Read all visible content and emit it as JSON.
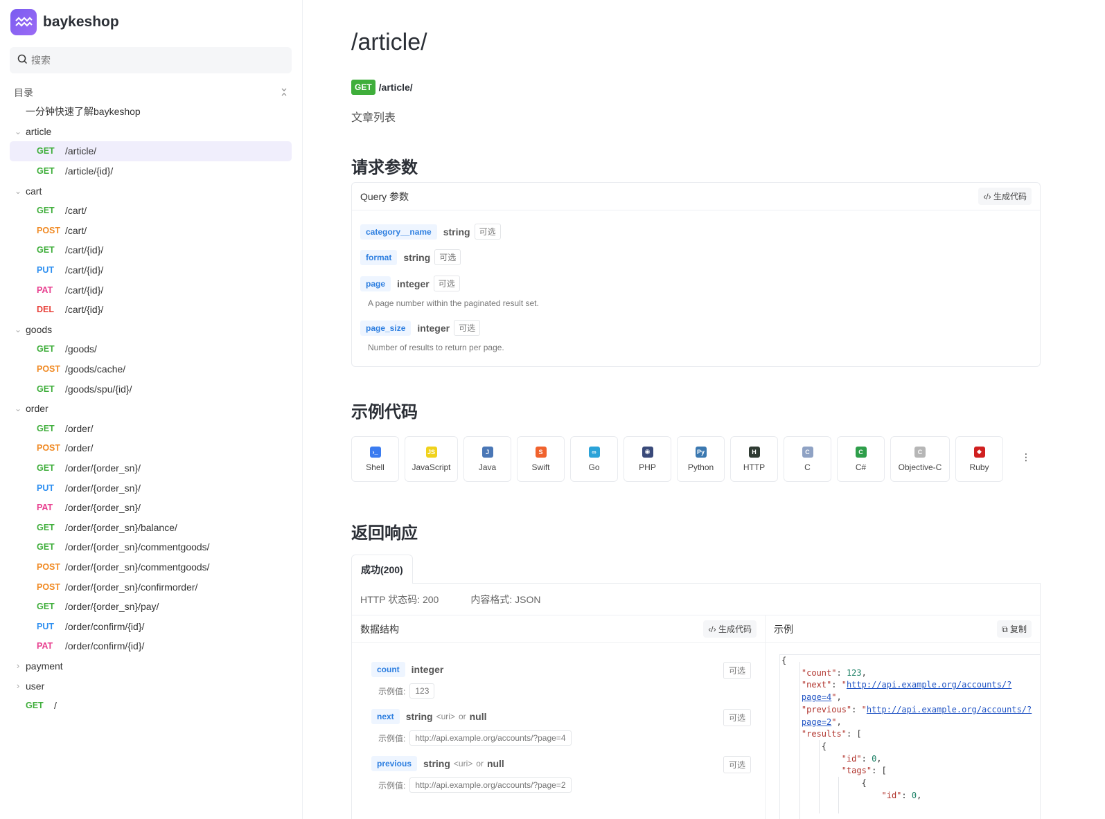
{
  "brand": {
    "name": "baykeshop"
  },
  "search": {
    "placeholder": "搜索"
  },
  "toc": {
    "label": "目录",
    "items": [
      {
        "type": "doc",
        "label": "一分钟快速了解baykeshop"
      },
      {
        "type": "group",
        "label": "article",
        "open": true
      },
      {
        "type": "api",
        "method": "GET",
        "path": "/article/",
        "active": true
      },
      {
        "type": "api",
        "method": "GET",
        "path": "/article/{id}/"
      },
      {
        "type": "group",
        "label": "cart",
        "open": true
      },
      {
        "type": "api",
        "method": "GET",
        "path": "/cart/"
      },
      {
        "type": "api",
        "method": "POST",
        "path": "/cart/"
      },
      {
        "type": "api",
        "method": "GET",
        "path": "/cart/{id}/"
      },
      {
        "type": "api",
        "method": "PUT",
        "path": "/cart/{id}/"
      },
      {
        "type": "api",
        "method": "PAT",
        "path": "/cart/{id}/"
      },
      {
        "type": "api",
        "method": "DEL",
        "path": "/cart/{id}/"
      },
      {
        "type": "group",
        "label": "goods",
        "open": true
      },
      {
        "type": "api",
        "method": "GET",
        "path": "/goods/"
      },
      {
        "type": "api",
        "method": "POST",
        "path": "/goods/cache/"
      },
      {
        "type": "api",
        "method": "GET",
        "path": "/goods/spu/{id}/"
      },
      {
        "type": "group",
        "label": "order",
        "open": true
      },
      {
        "type": "api",
        "method": "GET",
        "path": "/order/"
      },
      {
        "type": "api",
        "method": "POST",
        "path": "/order/"
      },
      {
        "type": "api",
        "method": "GET",
        "path": "/order/{order_sn}/"
      },
      {
        "type": "api",
        "method": "PUT",
        "path": "/order/{order_sn}/"
      },
      {
        "type": "api",
        "method": "PAT",
        "path": "/order/{order_sn}/"
      },
      {
        "type": "api",
        "method": "GET",
        "path": "/order/{order_sn}/balance/"
      },
      {
        "type": "api",
        "method": "GET",
        "path": "/order/{order_sn}/commentgoods/"
      },
      {
        "type": "api",
        "method": "POST",
        "path": "/order/{order_sn}/commentgoods/"
      },
      {
        "type": "api",
        "method": "POST",
        "path": "/order/{order_sn}/confirmorder/"
      },
      {
        "type": "api",
        "method": "GET",
        "path": "/order/{order_sn}/pay/"
      },
      {
        "type": "api",
        "method": "PUT",
        "path": "/order/confirm/{id}/"
      },
      {
        "type": "api",
        "method": "PAT",
        "path": "/order/confirm/{id}/"
      },
      {
        "type": "group",
        "label": "payment",
        "open": false
      },
      {
        "type": "group",
        "label": "user",
        "open": false
      },
      {
        "type": "root",
        "method": "GET",
        "path": "/"
      }
    ]
  },
  "page": {
    "title": "/article/",
    "method": "GET",
    "path": "/article/",
    "description": "文章列表"
  },
  "request": {
    "heading": "请求参数",
    "panel_title": "Query 参数",
    "gen_code": "生成代码",
    "params": [
      {
        "name": "category__name",
        "type": "string",
        "optional": "可选",
        "desc": ""
      },
      {
        "name": "format",
        "type": "string",
        "optional": "可选",
        "desc": ""
      },
      {
        "name": "page",
        "type": "integer",
        "optional": "可选",
        "desc": "A page number within the paginated result set."
      },
      {
        "name": "page_size",
        "type": "integer",
        "optional": "可选",
        "desc": "Number of results to return per page."
      }
    ]
  },
  "examples": {
    "heading": "示例代码",
    "languages": [
      {
        "label": "Shell",
        "icon": "shell-icon",
        "color": "#3b7cf0"
      },
      {
        "label": "JavaScript",
        "icon": "javascript-icon",
        "color": "#f0d21c"
      },
      {
        "label": "Java",
        "icon": "java-icon",
        "color": "#4a77b6"
      },
      {
        "label": "Swift",
        "icon": "swift-icon",
        "color": "#f0622d"
      },
      {
        "label": "Go",
        "icon": "go-icon",
        "color": "#2ba3d8"
      },
      {
        "label": "PHP",
        "icon": "php-icon",
        "color": "#3a4a7a"
      },
      {
        "label": "Python",
        "icon": "python-icon",
        "color": "#3b78b0"
      },
      {
        "label": "HTTP",
        "icon": "http-icon",
        "color": "#2f3b33"
      },
      {
        "label": "C",
        "icon": "c-icon",
        "color": "#8fa2c4"
      },
      {
        "label": "C#",
        "icon": "csharp-icon",
        "color": "#2e9e4a"
      },
      {
        "label": "Objective-C",
        "icon": "objc-icon",
        "color": "#b6b6b6"
      },
      {
        "label": "Ruby",
        "icon": "ruby-icon",
        "color": "#d02020"
      }
    ]
  },
  "response": {
    "heading": "返回响应",
    "tab_label": "成功(200)",
    "status_label": "HTTP 状态码: 200",
    "format_label": "内容格式: JSON",
    "schema_title": "数据结构",
    "gen_code": "生成代码",
    "example_title": "示例",
    "copy_label": "复制",
    "example_prefix": "示例值:",
    "fields": [
      {
        "name": "count",
        "type": "integer",
        "meta": "",
        "nullable": "",
        "optional": "可选",
        "example": "123"
      },
      {
        "name": "next",
        "type": "string",
        "meta": "<uri>",
        "or": "or",
        "nullable": "null",
        "optional": "可选",
        "example": "http://api.example.org/accounts/?page=4"
      },
      {
        "name": "previous",
        "type": "string",
        "meta": "<uri>",
        "or": "or",
        "nullable": "null",
        "optional": "可选",
        "example": "http://api.example.org/accounts/?page=2"
      }
    ]
  }
}
